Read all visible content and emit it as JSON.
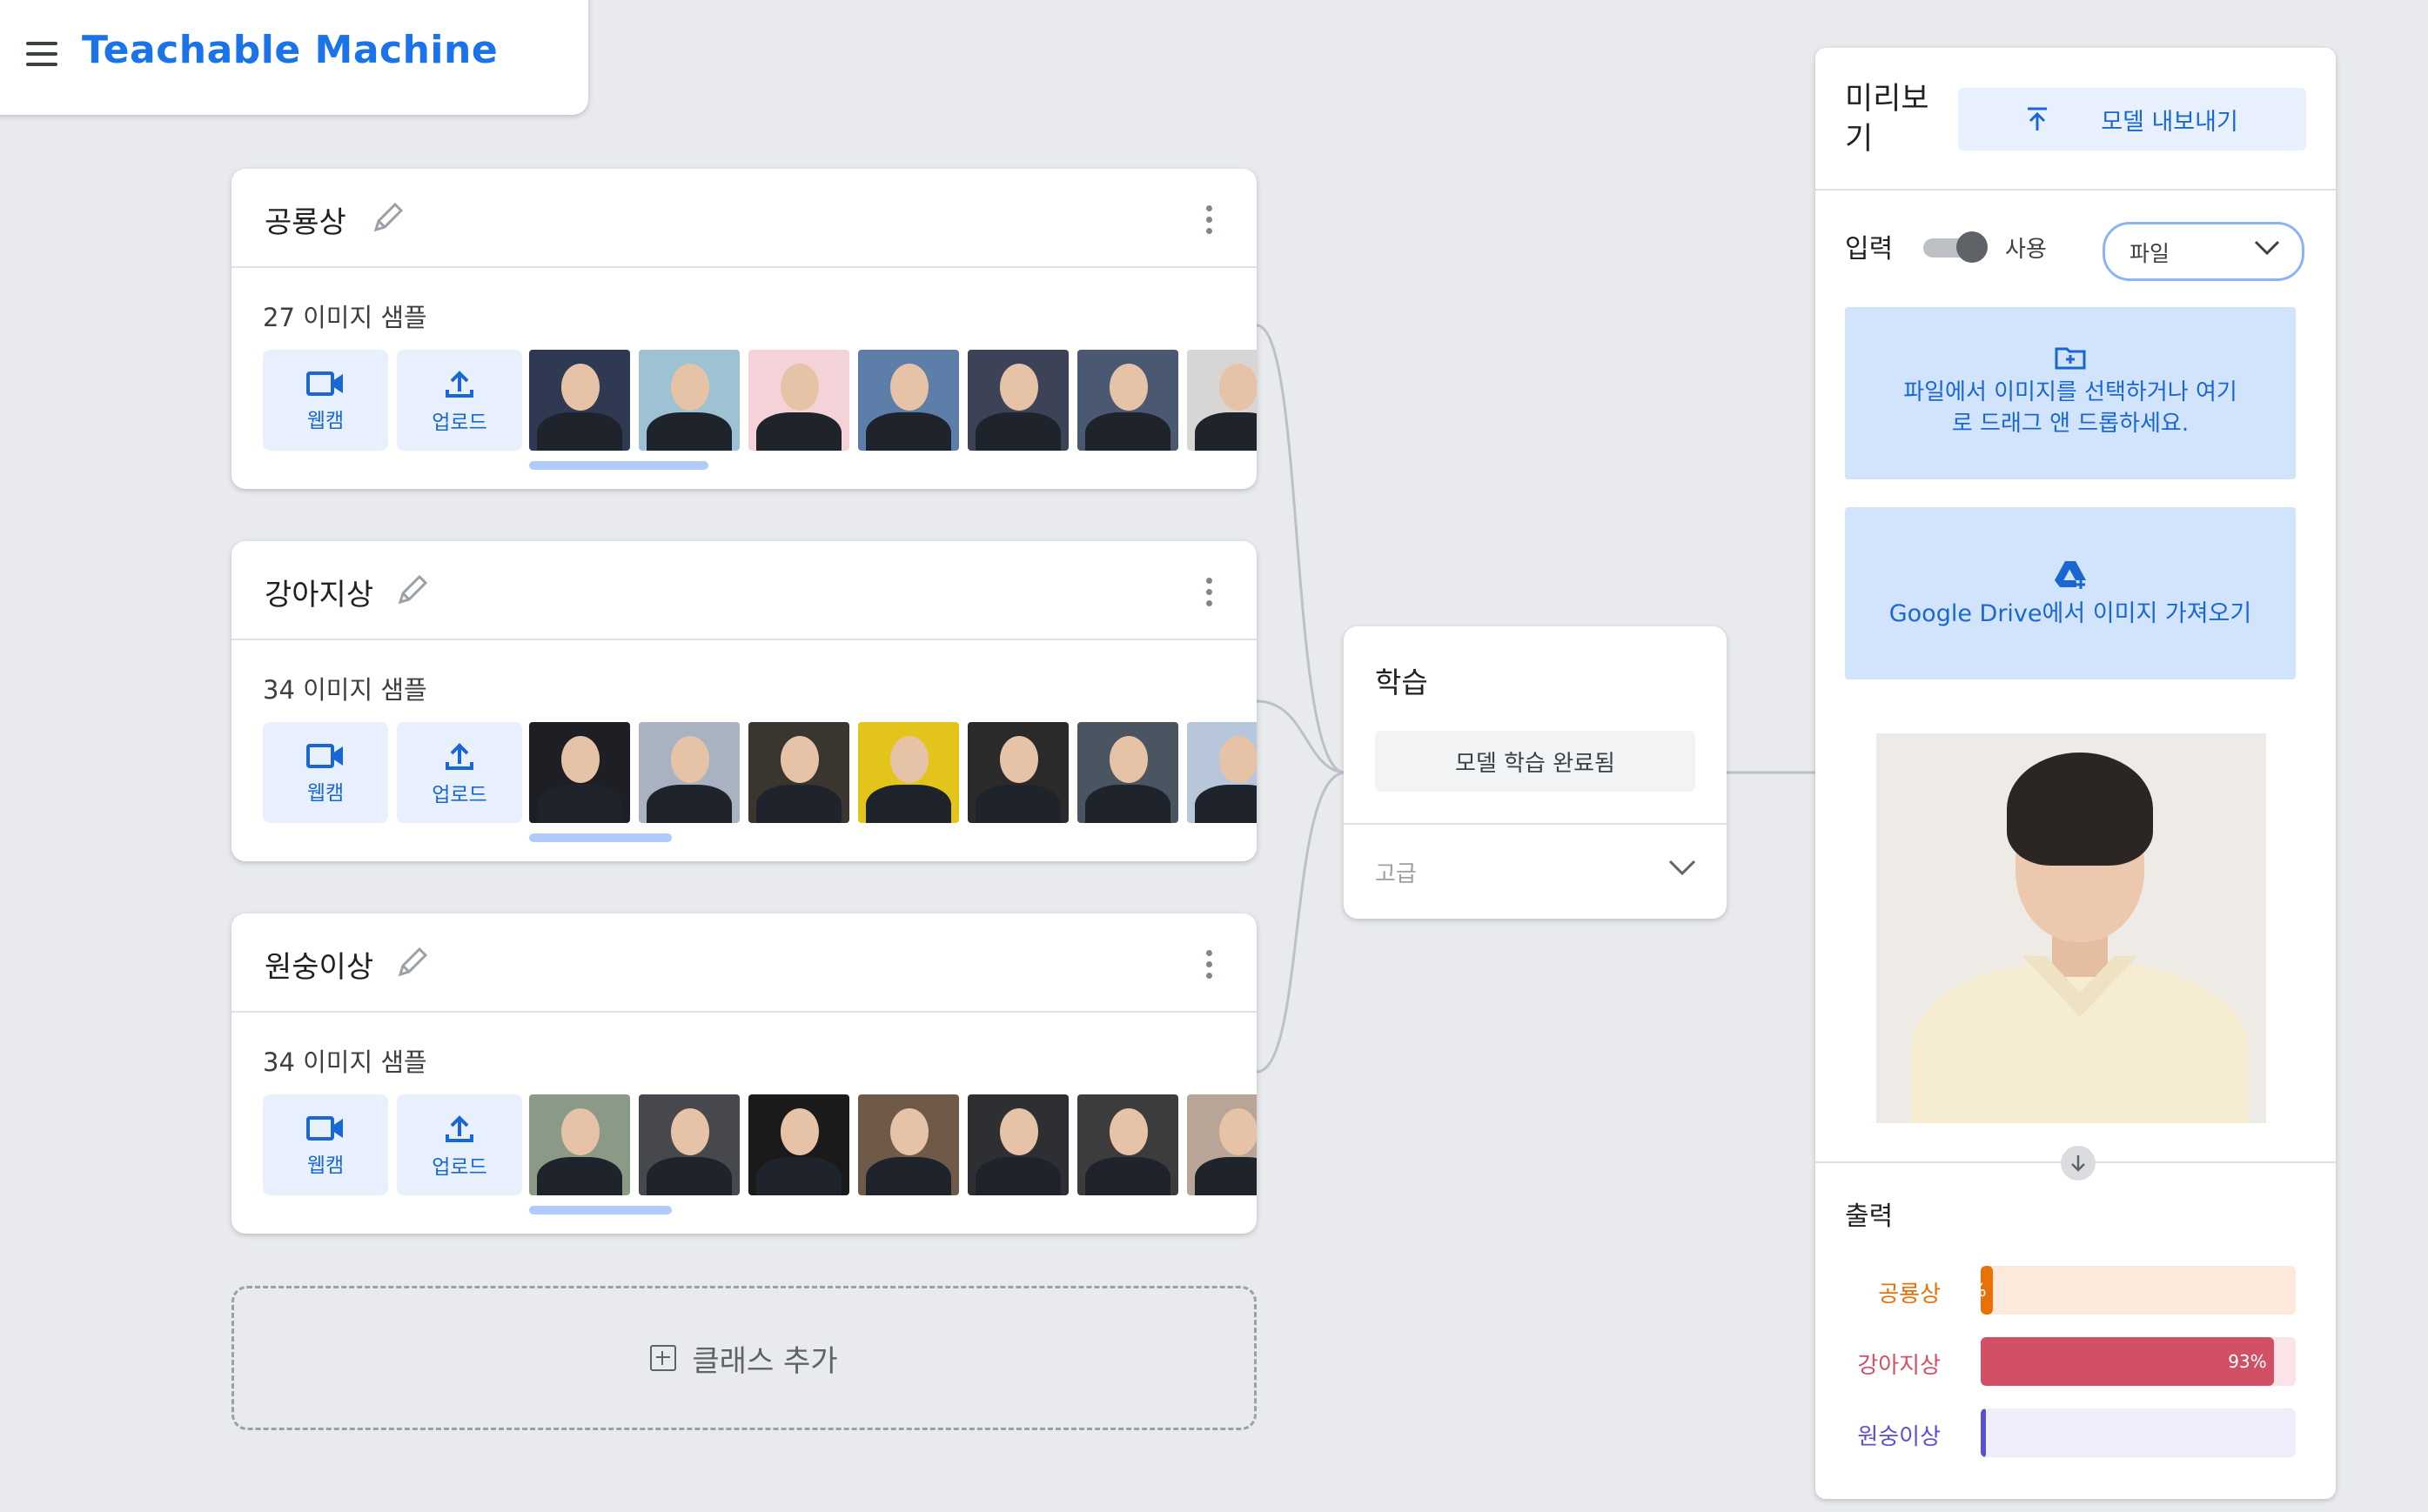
{
  "header": {
    "app_title": "Teachable Machine"
  },
  "classes": [
    {
      "name": "공룡상",
      "count_text": "27 이미지 샘플",
      "webcam_label": "웹캠",
      "upload_label": "업로드",
      "thumb_colors": [
        "#2f3a52",
        "#9cc2d4",
        "#f3d3d8",
        "#5d7ea8",
        "#3d4357",
        "#4a5871",
        "#d8d6d4"
      ]
    },
    {
      "name": "강아지상",
      "count_text": "34 이미지 샘플",
      "webcam_label": "웹캠",
      "upload_label": "업로드",
      "thumb_colors": [
        "#1e1f24",
        "#a8b2c0",
        "#3a352f",
        "#e2c41a",
        "#2a2a2a",
        "#4b5562",
        "#b8c6db"
      ]
    },
    {
      "name": "원숭이상",
      "count_text": "34 이미지 샘플",
      "webcam_label": "웹캠",
      "upload_label": "업로드",
      "thumb_colors": [
        "#8b9a86",
        "#47484d",
        "#1b1a1a",
        "#6f5a4a",
        "#2d2f33",
        "#3c3c3c",
        "#b9a597"
      ]
    }
  ],
  "add_class_label": "클래스 추가",
  "training": {
    "title": "학습",
    "button_label": "모델 학습 완료됨",
    "advanced_label": "고급"
  },
  "preview": {
    "title": "미리보기",
    "export_label": "모델 내보내기",
    "input_label": "입력",
    "toggle_label": "사용",
    "toggle_on": true,
    "input_source": "파일",
    "drop_text": "파일에서 이미지를 선택하거나 여기로 드래그 앤 드롭하세요.",
    "drive_text": "Google Drive에서 이미지 가져오기",
    "output_label": "출력"
  },
  "outputs": [
    {
      "name": "공룡상",
      "value": 4,
      "pct_label": "%",
      "color": "#e8710a",
      "bg": "#fde9dc"
    },
    {
      "name": "강아지상",
      "value": 93,
      "pct_label": "93%",
      "color": "#d25066",
      "bg": "#fbe3e7"
    },
    {
      "name": "원숭이상",
      "value": 1,
      "pct_label": "",
      "color": "#5a4fcf",
      "bg": "#eeeefb"
    }
  ],
  "colors": {
    "accent": "#1a73e8",
    "accent_light": "#e8f0fe",
    "drop_bg": "#d2e3fc"
  }
}
